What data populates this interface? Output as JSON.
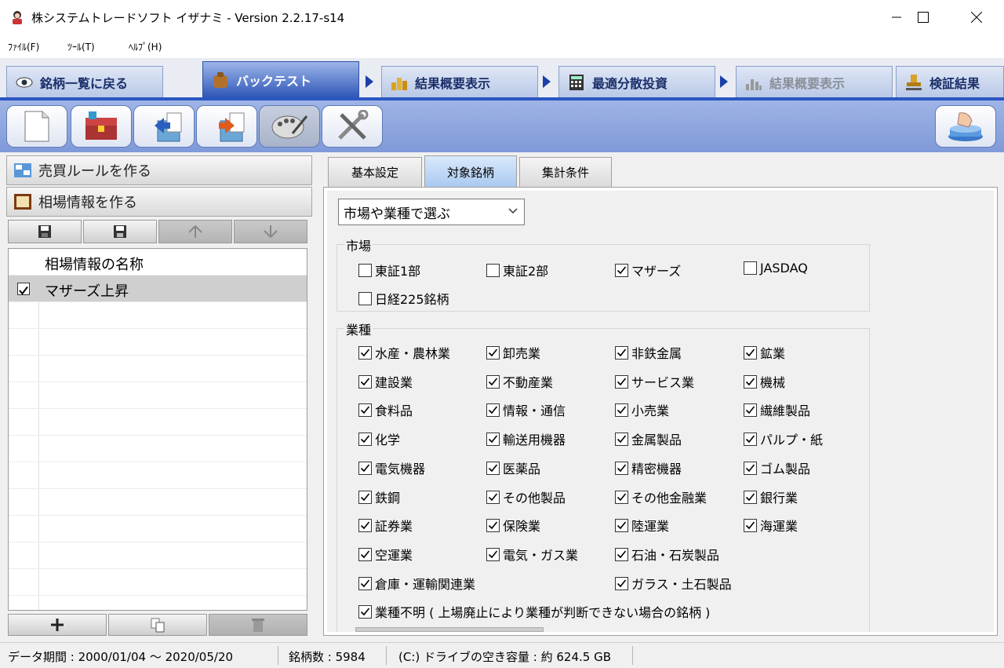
{
  "window": {
    "title": "株システムトレードソフト イザナミ - Version 2.2.17-s14"
  },
  "menu": [
    {
      "label": "ﾌｧｲﾙ(F)"
    },
    {
      "label": "ﾂｰﾙ(T)"
    },
    {
      "label": "ﾍﾙﾌﾟ(H)"
    }
  ],
  "navtabs": [
    {
      "label": "銘柄一覧に戻る",
      "icon": "eye-icon"
    },
    {
      "label": "バックテスト",
      "icon": "bag-icon"
    },
    {
      "label": "結果概要表示",
      "icon": "coins-icon"
    },
    {
      "label": "最適分散投資",
      "icon": "calculator-icon"
    },
    {
      "label": "結果概要表示",
      "icon": "chart-icon"
    },
    {
      "label": "検証結果",
      "icon": "stamp-icon"
    }
  ],
  "left": {
    "rule_button": "売買ルールを作る",
    "market_button": "相場情報を作る",
    "grid_header": "相場情報の名称",
    "rows": [
      {
        "checked": true,
        "name": "マザーズ上昇"
      }
    ]
  },
  "right": {
    "tabs": [
      "基本設定",
      "対象銘柄",
      "集計条件"
    ],
    "active_tab": "対象銘柄",
    "select_value": "市場や業種で選ぶ",
    "market_group": {
      "label": "市場",
      "items": [
        {
          "label": "東証1部",
          "checked": false
        },
        {
          "label": "東証2部",
          "checked": false
        },
        {
          "label": "マザーズ",
          "checked": true
        },
        {
          "label": "JASDAQ",
          "checked": false
        },
        {
          "label": "日経225銘柄",
          "checked": false
        }
      ]
    },
    "industry_group": {
      "label": "業種",
      "items": [
        {
          "label": "水産・農林業",
          "checked": true
        },
        {
          "label": "卸売業",
          "checked": true
        },
        {
          "label": "非鉄金属",
          "checked": true
        },
        {
          "label": "鉱業",
          "checked": true
        },
        {
          "label": "建設業",
          "checked": true
        },
        {
          "label": "不動産業",
          "checked": true
        },
        {
          "label": "サービス業",
          "checked": true
        },
        {
          "label": "機械",
          "checked": true
        },
        {
          "label": "食料品",
          "checked": true
        },
        {
          "label": "情報・通信",
          "checked": true
        },
        {
          "label": "小売業",
          "checked": true
        },
        {
          "label": "繊維製品",
          "checked": true
        },
        {
          "label": "化学",
          "checked": true
        },
        {
          "label": "輸送用機器",
          "checked": true
        },
        {
          "label": "金属製品",
          "checked": true
        },
        {
          "label": "パルプ・紙",
          "checked": true
        },
        {
          "label": "電気機器",
          "checked": true
        },
        {
          "label": "医薬品",
          "checked": true
        },
        {
          "label": "精密機器",
          "checked": true
        },
        {
          "label": "ゴム製品",
          "checked": true
        },
        {
          "label": "鉄鋼",
          "checked": true
        },
        {
          "label": "その他製品",
          "checked": true
        },
        {
          "label": "その他金融業",
          "checked": true
        },
        {
          "label": "銀行業",
          "checked": true
        },
        {
          "label": "証券業",
          "checked": true
        },
        {
          "label": "保険業",
          "checked": true
        },
        {
          "label": "陸運業",
          "checked": true
        },
        {
          "label": "海運業",
          "checked": true
        },
        {
          "label": "空運業",
          "checked": true
        },
        {
          "label": "電気・ガス業",
          "checked": true
        },
        {
          "label": "石油・石炭製品",
          "checked": true
        },
        {
          "label": "倉庫・運輸関連業",
          "checked": true
        },
        {
          "label": "ガラス・土石製品",
          "checked": true
        },
        {
          "label": "業種不明 ( 上場廃止により業種が判断できない場合の銘柄 )",
          "checked": true
        }
      ]
    }
  },
  "status": {
    "period": "データ期間 : 2000/01/04 〜 2020/05/20",
    "count": "銘柄数 : 5984",
    "disk": "(C:) ドライブの空き容量 : 約 624.5 GB"
  }
}
